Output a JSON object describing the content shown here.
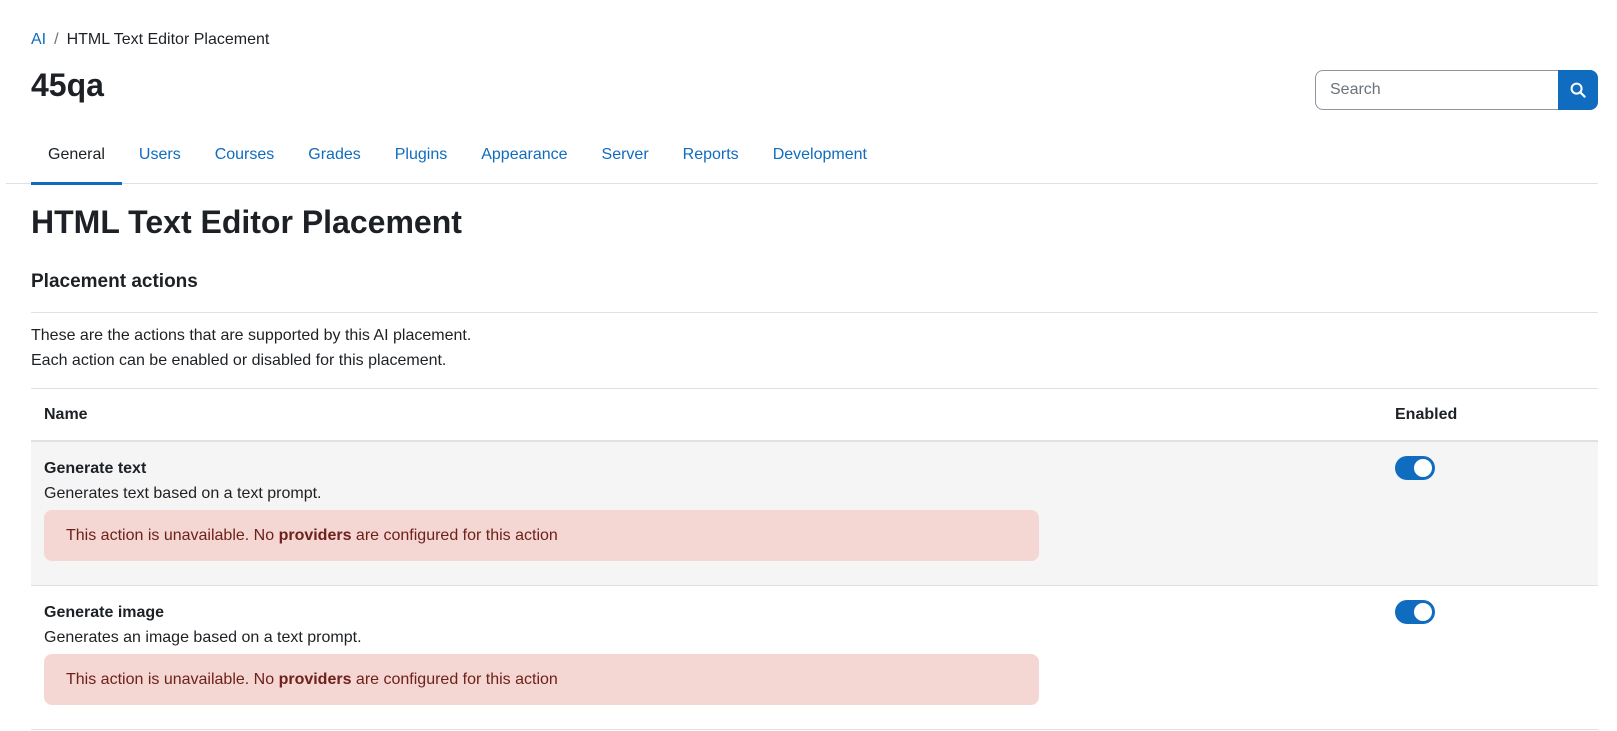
{
  "breadcrumb": {
    "root": "AI",
    "separator": "/",
    "current": "HTML Text Editor Placement"
  },
  "site_title": "45qa",
  "search": {
    "placeholder": "Search",
    "icon": "search-icon"
  },
  "tabs": [
    {
      "label": "General",
      "active": true
    },
    {
      "label": "Users"
    },
    {
      "label": "Courses"
    },
    {
      "label": "Grades"
    },
    {
      "label": "Plugins"
    },
    {
      "label": "Appearance"
    },
    {
      "label": "Server"
    },
    {
      "label": "Reports"
    },
    {
      "label": "Development"
    }
  ],
  "page_heading": "HTML Text Editor Placement",
  "section": {
    "heading": "Placement actions",
    "description_line1": "These are the actions that are supported by this AI placement.",
    "description_line2": "Each action can be enabled or disabled for this placement."
  },
  "table": {
    "headers": {
      "name": "Name",
      "enabled": "Enabled"
    },
    "rows": [
      {
        "title": "Generate text",
        "description": "Generates text based on a text prompt.",
        "alert_prefix": "This action is unavailable. No ",
        "alert_bold": "providers",
        "alert_suffix": " are configured for this action",
        "enabled": true
      },
      {
        "title": "Generate image",
        "description": "Generates an image based on a text prompt.",
        "alert_prefix": "This action is unavailable. No ",
        "alert_bold": "providers",
        "alert_suffix": " are configured for this action",
        "enabled": true
      }
    ]
  },
  "colors": {
    "accent": "#0f6cbf",
    "alert_bg": "#f4d6d2",
    "alert_text": "#6e211a"
  }
}
